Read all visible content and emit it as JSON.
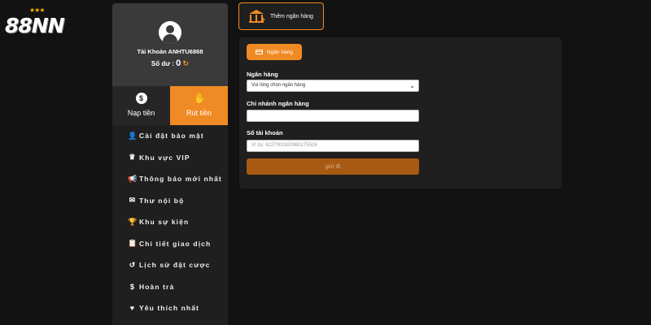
{
  "brand": {
    "logo_text": "88NN",
    "stars": "★★★"
  },
  "profile": {
    "account_label": "Tài Khoản ANHTU6868",
    "balance_label": "Số dư :",
    "balance_value": "0",
    "refresh_glyph": "↻"
  },
  "tabs": {
    "deposit": {
      "label": "Nạp tiền",
      "icon": "$"
    },
    "withdraw": {
      "label": "Rút tiền",
      "icon": "✋"
    }
  },
  "menu": [
    {
      "label": "Cài đặt bảo mật",
      "icon": "👤"
    },
    {
      "label": "Khu vực VIP",
      "icon": "♛"
    },
    {
      "label": "Thông báo mới nhất",
      "icon": "📢"
    },
    {
      "label": "Thư nội bộ",
      "icon": "✉"
    },
    {
      "label": "Khu sự kiện",
      "icon": "🏆"
    },
    {
      "label": "Chi tiết giao dịch",
      "icon": "📋"
    },
    {
      "label": "Lịch sử đặt cược",
      "icon": "↺"
    },
    {
      "label": "Hoàn trả",
      "icon": "$"
    },
    {
      "label": "Yêu thích nhất",
      "icon": "♥"
    }
  ],
  "add_bank": {
    "label": "Thêm ngân hàng"
  },
  "form": {
    "bank_tab": "Ngân hàng",
    "bank_label": "Ngân hàng",
    "bank_select_value": "Vui lòng chọn ngân hàng",
    "branch_label": "Chi nhánh ngân hàng",
    "branch_value": "",
    "account_no_label": "Số tài khoản",
    "account_no_placeholder": "Ví dụ:  6227002820980175526",
    "submit_label": "gửi đi"
  },
  "colors": {
    "accent": "#f08a24",
    "background": "#121212",
    "panel": "#1f1f1f"
  }
}
